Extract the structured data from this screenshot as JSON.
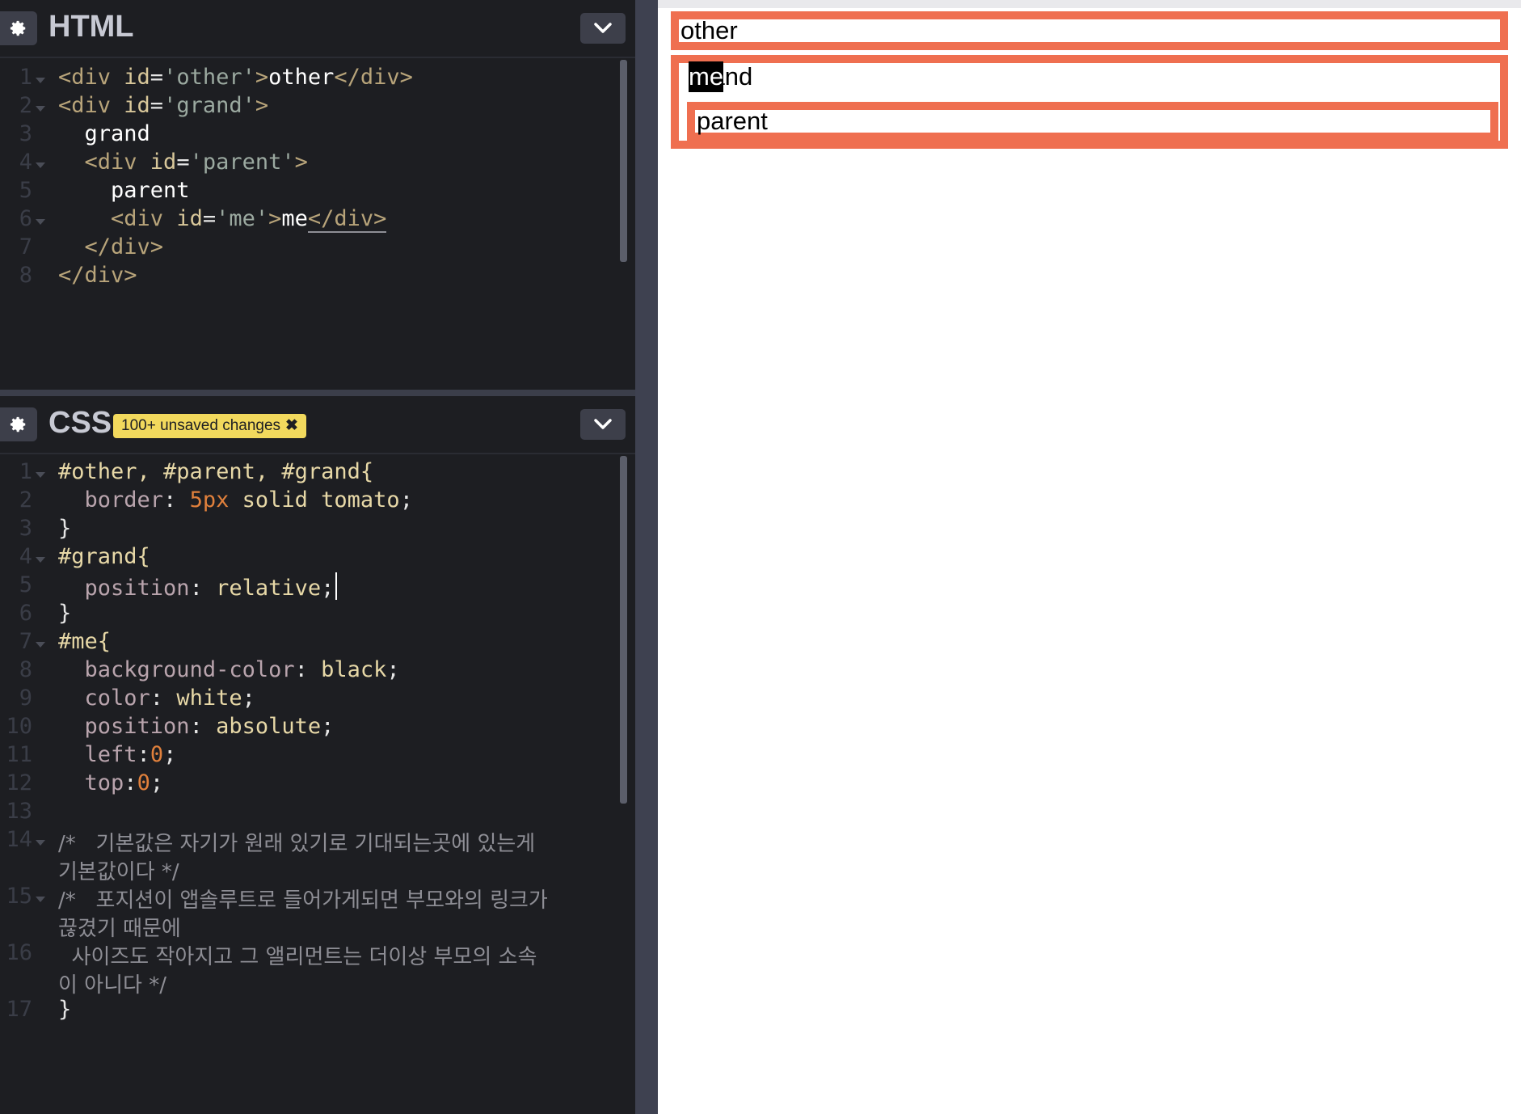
{
  "html_panel": {
    "title": "HTML",
    "line_numbers": [
      "1",
      "2",
      "3",
      "4",
      "5",
      "6",
      "7",
      "8"
    ],
    "lines": [
      {
        "tokens": [
          {
            "t": "<div ",
            "c": "tag"
          },
          {
            "t": "id",
            "c": "attr"
          },
          {
            "t": "=",
            "c": "pun"
          },
          {
            "t": "'other'",
            "c": "str"
          },
          {
            "t": ">",
            "c": "tag"
          },
          {
            "t": "other",
            "c": "txt"
          },
          {
            "t": "</div>",
            "c": "tag"
          }
        ]
      },
      {
        "tokens": [
          {
            "t": "<div ",
            "c": "tag"
          },
          {
            "t": "id",
            "c": "attr"
          },
          {
            "t": "=",
            "c": "pun"
          },
          {
            "t": "'grand'",
            "c": "str"
          },
          {
            "t": ">",
            "c": "tag"
          }
        ]
      },
      {
        "tokens": [
          {
            "t": "  ",
            "c": "txt"
          },
          {
            "t": "grand",
            "c": "txt"
          }
        ]
      },
      {
        "tokens": [
          {
            "t": "  ",
            "c": "txt"
          },
          {
            "t": "<div ",
            "c": "tag"
          },
          {
            "t": "id",
            "c": "attr"
          },
          {
            "t": "=",
            "c": "pun"
          },
          {
            "t": "'parent'",
            "c": "str"
          },
          {
            "t": ">",
            "c": "tag"
          }
        ]
      },
      {
        "tokens": [
          {
            "t": "    ",
            "c": "txt"
          },
          {
            "t": "parent",
            "c": "txt"
          }
        ]
      },
      {
        "tokens": [
          {
            "t": "    ",
            "c": "txt"
          },
          {
            "t": "<div ",
            "c": "tag"
          },
          {
            "t": "id",
            "c": "attr"
          },
          {
            "t": "=",
            "c": "pun"
          },
          {
            "t": "'me'",
            "c": "str"
          },
          {
            "t": ">",
            "c": "tag"
          },
          {
            "t": "me",
            "c": "txt"
          },
          {
            "t": "</div>",
            "c": "tag underline"
          }
        ]
      },
      {
        "tokens": [
          {
            "t": "  ",
            "c": "txt"
          },
          {
            "t": "</div>",
            "c": "tag"
          }
        ]
      },
      {
        "tokens": [
          {
            "t": "</div>",
            "c": "tag"
          }
        ]
      }
    ]
  },
  "css_panel": {
    "title": "CSS",
    "badge": "100+ unsaved changes",
    "badge_close": "✖",
    "line_numbers": [
      "1",
      "2",
      "3",
      "4",
      "5",
      "6",
      "7",
      "8",
      "9",
      "10",
      "11",
      "12",
      "13",
      "14",
      "",
      "15",
      "",
      "16",
      "",
      "17"
    ],
    "lines": [
      {
        "tokens": [
          {
            "t": "#other, #parent, #grand{",
            "c": "sel"
          }
        ]
      },
      {
        "tokens": [
          {
            "t": "  ",
            "c": "pun"
          },
          {
            "t": "border",
            "c": "prop"
          },
          {
            "t": ": ",
            "c": "pun"
          },
          {
            "t": "5px",
            "c": "num"
          },
          {
            "t": " solid tomato",
            "c": "val"
          },
          {
            "t": ";",
            "c": "pun"
          }
        ]
      },
      {
        "tokens": [
          {
            "t": "}",
            "c": "pun"
          }
        ]
      },
      {
        "tokens": [
          {
            "t": "#grand{",
            "c": "sel"
          }
        ]
      },
      {
        "tokens": [
          {
            "t": "  ",
            "c": "pun"
          },
          {
            "t": "position",
            "c": "prop"
          },
          {
            "t": ": ",
            "c": "pun"
          },
          {
            "t": "relative",
            "c": "val"
          },
          {
            "t": ";",
            "c": "pun"
          }
        ]
      },
      {
        "tokens": [
          {
            "t": "}",
            "c": "pun"
          }
        ]
      },
      {
        "tokens": [
          {
            "t": "#me{",
            "c": "sel"
          }
        ]
      },
      {
        "tokens": [
          {
            "t": "  ",
            "c": "pun"
          },
          {
            "t": "background-color",
            "c": "prop"
          },
          {
            "t": ": ",
            "c": "pun"
          },
          {
            "t": "black",
            "c": "val"
          },
          {
            "t": ";",
            "c": "pun"
          }
        ]
      },
      {
        "tokens": [
          {
            "t": "  ",
            "c": "pun"
          },
          {
            "t": "color",
            "c": "prop"
          },
          {
            "t": ": ",
            "c": "pun"
          },
          {
            "t": "white",
            "c": "val"
          },
          {
            "t": ";",
            "c": "pun"
          }
        ]
      },
      {
        "tokens": [
          {
            "t": "  ",
            "c": "pun"
          },
          {
            "t": "position",
            "c": "prop"
          },
          {
            "t": ": ",
            "c": "pun"
          },
          {
            "t": "absolute",
            "c": "val"
          },
          {
            "t": ";",
            "c": "pun"
          }
        ]
      },
      {
        "tokens": [
          {
            "t": "  ",
            "c": "pun"
          },
          {
            "t": "left",
            "c": "prop"
          },
          {
            "t": ":",
            "c": "pun"
          },
          {
            "t": "0",
            "c": "num"
          },
          {
            "t": ";",
            "c": "pun"
          }
        ]
      },
      {
        "tokens": [
          {
            "t": "  ",
            "c": "pun"
          },
          {
            "t": "top",
            "c": "prop"
          },
          {
            "t": ":",
            "c": "pun"
          },
          {
            "t": "0",
            "c": "num"
          },
          {
            "t": ";",
            "c": "pun"
          }
        ]
      },
      {
        "tokens": []
      },
      {
        "tokens": [
          {
            "t": "/*   기본값은 자기가 원래 있기로 기대되는곳에 있는게",
            "c": "cmt"
          }
        ]
      },
      {
        "tokens": [
          {
            "t": "기본값이다 */",
            "c": "cmt"
          }
        ]
      },
      {
        "tokens": [
          {
            "t": "/*   포지션이 앱솔루트로 들어가게되면 부모와의 링크가",
            "c": "cmt"
          }
        ]
      },
      {
        "tokens": [
          {
            "t": "끊겼기 때문에",
            "c": "cmt"
          }
        ]
      },
      {
        "tokens": [
          {
            "t": "  사이즈도 작아지고 그 앨리먼트는 더이상 부모의 소속",
            "c": "cmt"
          }
        ]
      },
      {
        "tokens": [
          {
            "t": "이 아니다 */",
            "c": "cmt"
          }
        ]
      },
      {
        "tokens": [
          {
            "t": "}",
            "c": "pun"
          }
        ]
      }
    ]
  },
  "preview": {
    "other": "other",
    "grand": "grand",
    "parent": "parent",
    "me": "me"
  },
  "icons": {
    "settings": "gear-icon",
    "collapse": "chevron-down-icon"
  },
  "colors": {
    "tomato_border": "#ef6f50",
    "editor_bg": "#1d1e22",
    "badge_bg": "#f2d95d"
  }
}
